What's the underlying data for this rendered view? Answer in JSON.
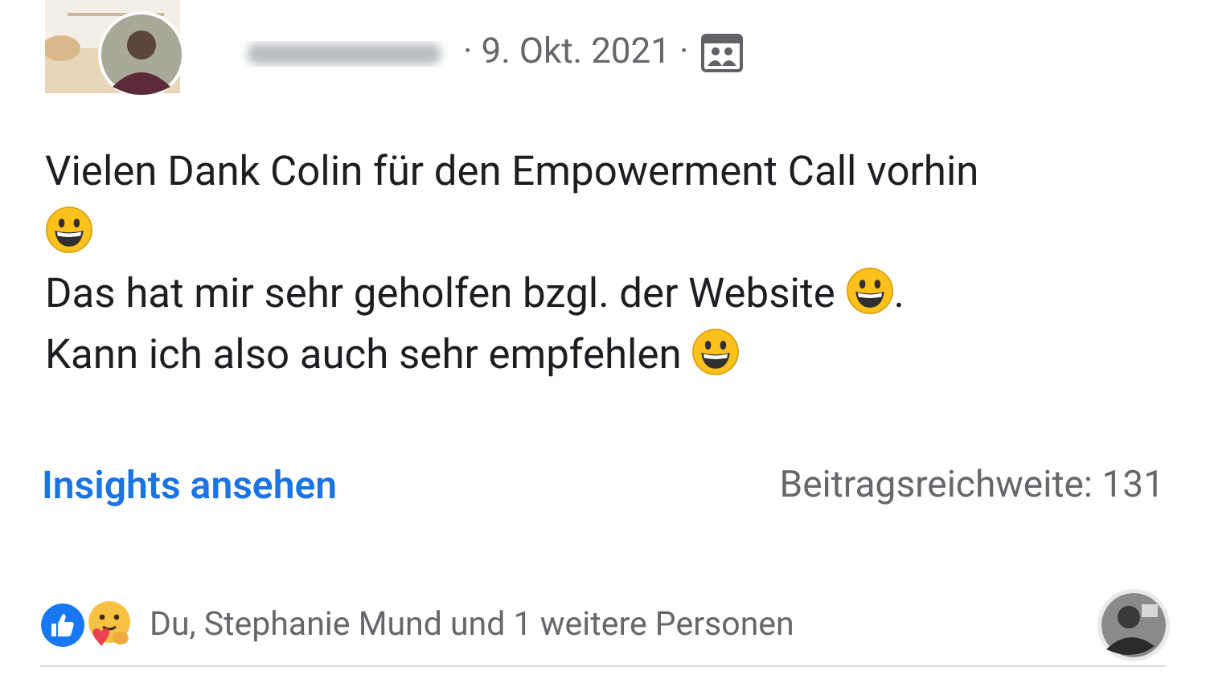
{
  "post": {
    "date": "· 9. Okt. 2021 ·",
    "lines": [
      [
        {
          "kind": "text",
          "text": "Vielen Dank Colin für den Empowerment Call vorhin"
        }
      ],
      [
        {
          "kind": "emoji"
        }
      ],
      [
        {
          "kind": "text",
          "text": "Das hat mir sehr geholfen bzgl. der Website "
        },
        {
          "kind": "emoji"
        },
        {
          "kind": "text",
          "text": "."
        }
      ],
      [
        {
          "kind": "text",
          "text": "Kann ich also auch sehr empfehlen "
        },
        {
          "kind": "emoji"
        }
      ]
    ],
    "insights_link": "Insights ansehen",
    "reach": "Beitragsreichweite: 131",
    "reactions_text": "Du, Stephanie Mund und 1 weitere Personen"
  }
}
